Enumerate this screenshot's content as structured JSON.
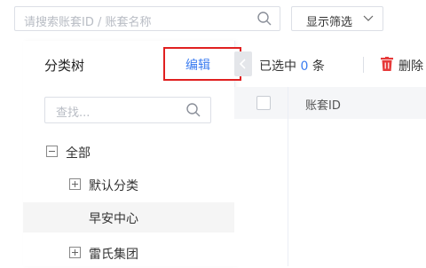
{
  "search": {
    "placeholder": "请搜索账套ID / 账套名称"
  },
  "filter": {
    "label": "显示筛选"
  },
  "sidebar": {
    "title": "分类树",
    "edit_label": "编辑",
    "search_placeholder": "查找...",
    "tree": [
      {
        "label": "全部",
        "toggle": "minus",
        "level": 0
      },
      {
        "label": "默认分类",
        "toggle": "plus",
        "level": 1
      },
      {
        "label": "早安中心",
        "toggle": "none",
        "level": 1,
        "selected": true
      },
      {
        "label": "雷氏集团",
        "toggle": "plus",
        "level": 1
      }
    ]
  },
  "toolbar": {
    "selected_prefix": "已选中",
    "selected_count": "0",
    "selected_suffix": "条",
    "delete_label": "删除"
  },
  "table": {
    "columns": [
      "账套ID"
    ]
  },
  "colors": {
    "accent": "#3b7cf0",
    "highlight_border": "#e02020",
    "delete_icon": "#e63a3a"
  }
}
